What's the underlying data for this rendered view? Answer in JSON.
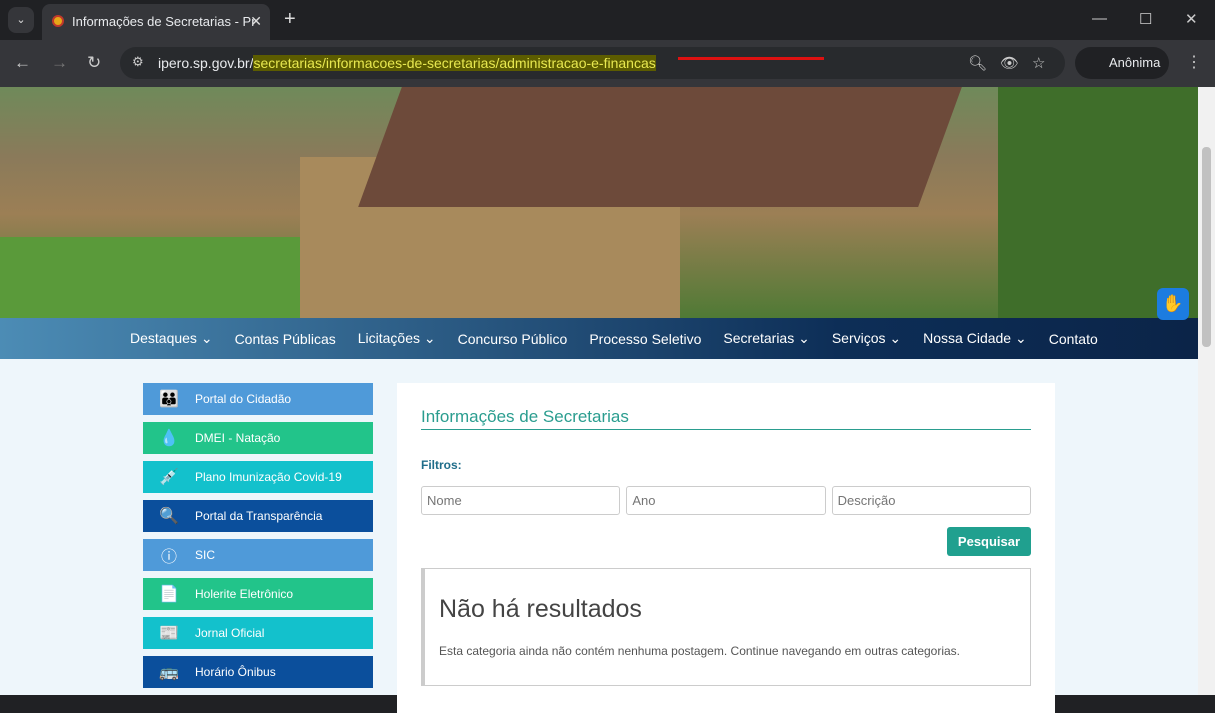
{
  "browser": {
    "tab_title": "Informações de Secretarias - Pr",
    "url_host": "ipero.sp.gov.br/",
    "url_path": "secretarias/informacoes-de-secretarias/administracao-e-financas",
    "profile": "Anônima"
  },
  "menu": [
    "Destaques ⌄",
    "Contas Públicas",
    "Licitações ⌄",
    "Concurso Público",
    "Processo Seletivo",
    "Secretarias ⌄",
    "Serviços ⌄",
    "Nossa Cidade ⌄",
    "Contato"
  ],
  "sidebar": [
    {
      "label": "Portal do Cidadão",
      "color": "#4f9ad9",
      "icon": "👪"
    },
    {
      "label": "DMEI - Natação",
      "color": "#22c48a",
      "icon": "💧"
    },
    {
      "label": "Plano Imunização Covid-19",
      "color": "#13c1cc",
      "icon": "💉"
    },
    {
      "label": "Portal da Transparência",
      "color": "#0b4f9c",
      "icon": "🔍"
    },
    {
      "label": "SIC",
      "color": "#4f9ad9",
      "icon": "ⓘ"
    },
    {
      "label": "Holerite Eletrônico",
      "color": "#22c48a",
      "icon": "📄"
    },
    {
      "label": "Jornal Oficial",
      "color": "#13c1cc",
      "icon": "📰"
    },
    {
      "label": "Horário Ônibus",
      "color": "#0b4f9c",
      "icon": "🚌"
    }
  ],
  "content": {
    "title": "Informações de Secretarias",
    "filters_label": "Filtros:",
    "ph_name": "Nome",
    "ph_year": "Ano",
    "ph_desc": "Descrição",
    "search": "Pesquisar",
    "empty_title": "Não há resultados",
    "empty_text": "Esta categoria ainda não contém nenhuma postagem. Continue navegando em outras categorias."
  }
}
